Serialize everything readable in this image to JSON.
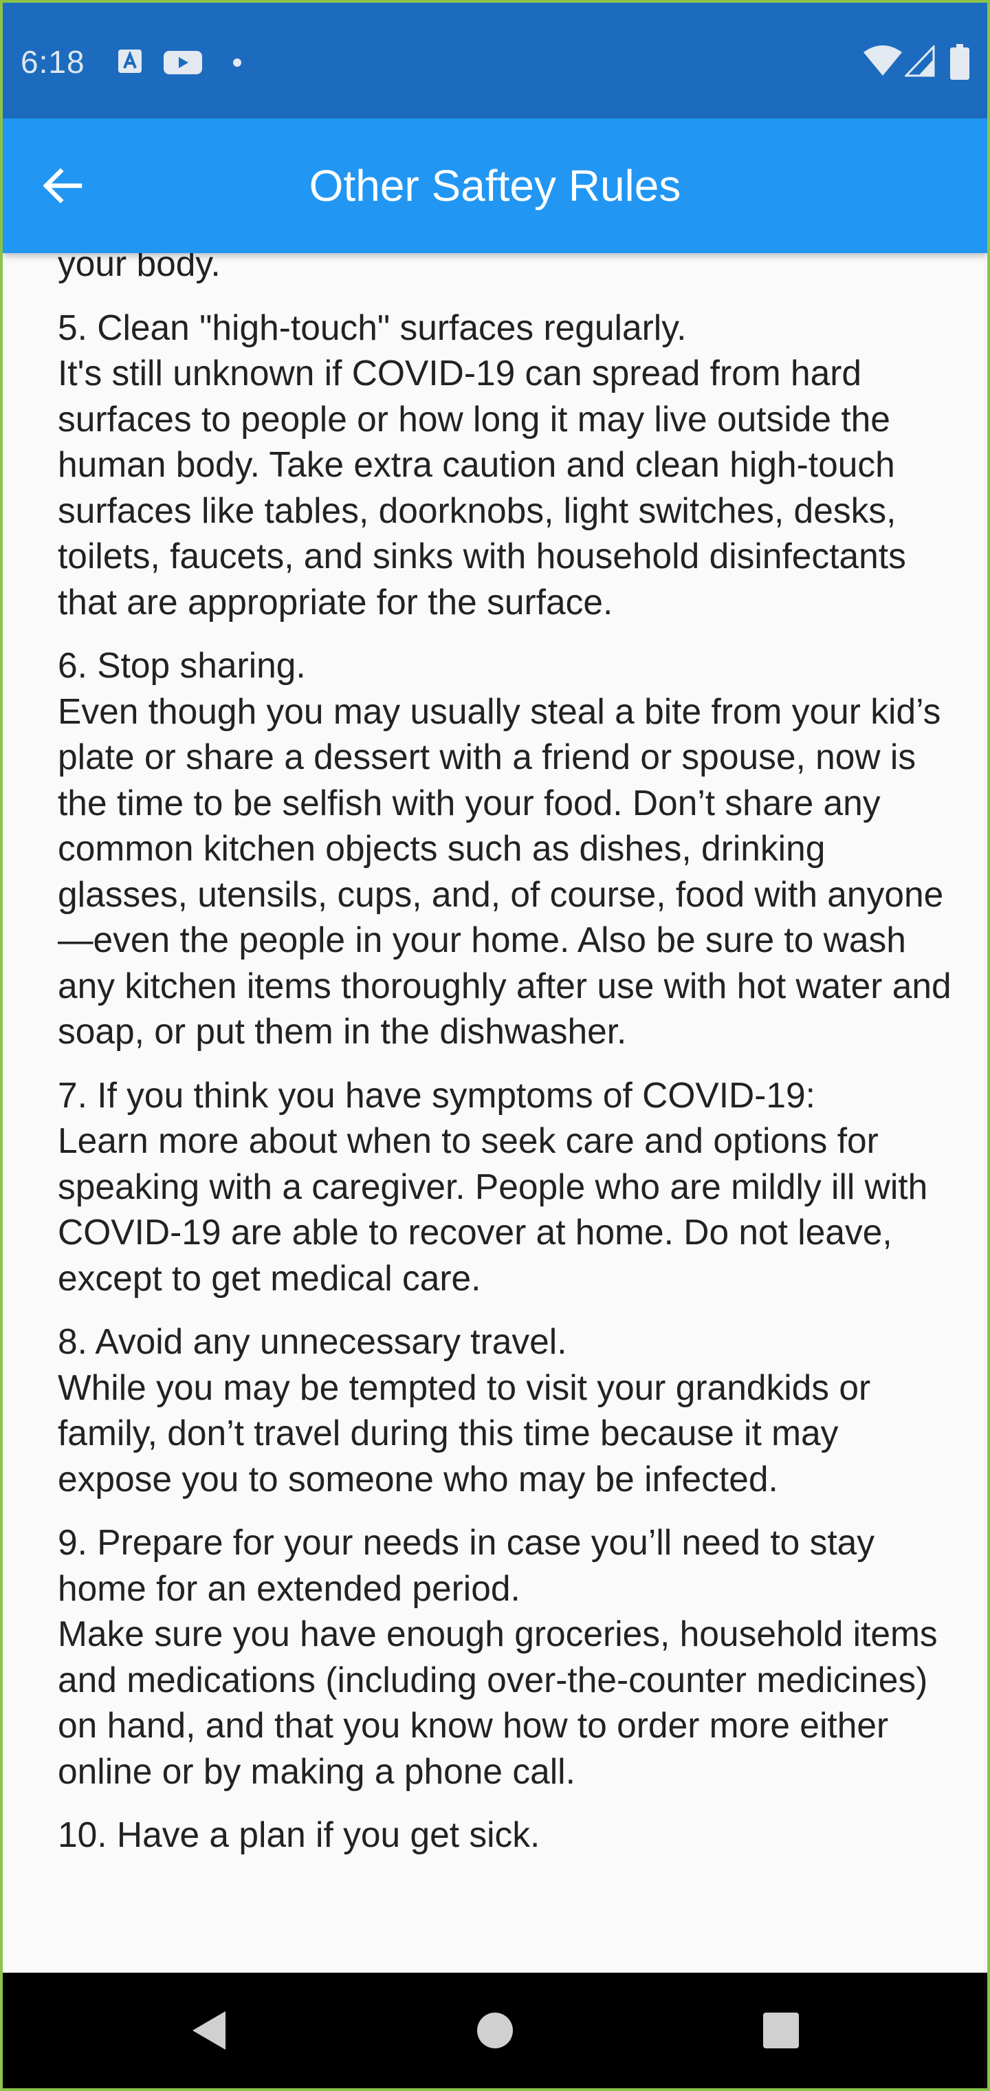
{
  "status_bar": {
    "time": "6:18",
    "icons": [
      "a-notification-icon",
      "youtube-icon",
      "dot-icon",
      "wifi-icon",
      "signal-icon",
      "battery-icon"
    ]
  },
  "app_bar": {
    "back_icon": "arrow-back-icon",
    "title": "Other Saftey Rules",
    "background_color": "#2196f3"
  },
  "content": {
    "blocks": [
      "your body.",
      "5. Clean \"high-touch\" surfaces regularly.\nIt's still unknown if COVID-19 can spread from hard surfaces to people or how long it may live outside the human body. Take extra caution and clean high-touch surfaces like tables, doorknobs, light switches, desks, toilets, faucets, and sinks with household disinfectants that are appropriate for the surface.",
      "6. Stop sharing.\nEven though you may usually steal a bite from your kid’s plate or share a dessert with a friend or spouse, now is the time to be selfish with your food. Don’t share any common kitchen objects such as dishes, drinking glasses, utensils, cups, and, of course, food with anyone—even the people in your home. Also be sure to wash any kitchen items thoroughly after use with hot water and soap, or put them in the dishwasher.",
      "7. If you think you have symptoms of COVID-19:\nLearn more about when to seek care and options for speaking with a caregiver. People who are mildly ill with COVID-19 are able to recover at home. Do not leave, except to get medical care.",
      "8. Avoid any unnecessary travel.\nWhile you may be tempted to visit your grandkids or family, don’t travel during this time because it may expose you to someone who may be infected.",
      "9. Prepare for your needs in case you’ll need to stay home for an extended period.\nMake sure you have enough groceries, household items and medications (including over-the-counter medicines) on hand, and that you know how to order more either online or by making a phone call.",
      "10. Have a plan if you get sick."
    ]
  },
  "nav_bar": {
    "icons": [
      "nav-back-icon",
      "nav-home-icon",
      "nav-recents-icon"
    ]
  }
}
